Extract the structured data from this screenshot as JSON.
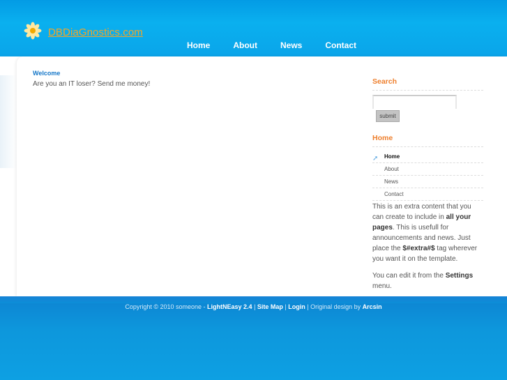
{
  "site": {
    "title": "DBDiaGnostics.com"
  },
  "nav": {
    "items": [
      "Home",
      "About",
      "News",
      "Contact"
    ]
  },
  "main": {
    "heading": "Welcome",
    "text": "Are you an IT loser? Send me money!"
  },
  "sidebar": {
    "search_title": "Search",
    "search_value": "",
    "submit_label": "submit",
    "home_title": "Home",
    "menu": [
      {
        "label": "Home",
        "active": true
      },
      {
        "label": "About",
        "active": false
      },
      {
        "label": "News",
        "active": false
      },
      {
        "label": "Contact",
        "active": false
      }
    ],
    "extra": {
      "p1_a": "This is an extra content that you can create to include in ",
      "p1_b": "all your pages",
      "p1_c": ". This is usefull for announcements and news. Just place the ",
      "p1_d": "$#extra#$",
      "p1_e": " tag wherever you want it on the template.",
      "p2_a": "You can edit it from the ",
      "p2_b": "Settings",
      "p2_c": " menu."
    }
  },
  "footer": {
    "copyright": "Copyright © 2010 someone - ",
    "link1": "LightNEasy 2.4",
    "sep1": " | ",
    "link2": "Site Map",
    "sep2": " | ",
    "link3": "Login",
    "sep3": " | Original design by ",
    "link4": "Arcsin"
  },
  "colors": {
    "accent_orange": "#ee7f2d",
    "link_blue": "#1577c8",
    "header_blue": "#0aa6ea"
  }
}
